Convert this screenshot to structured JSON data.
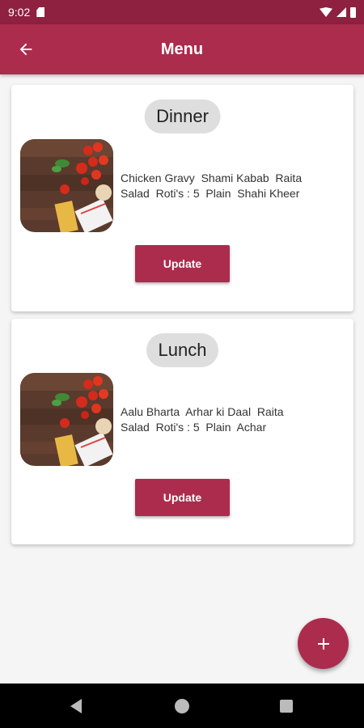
{
  "status_bar": {
    "time": "9:02"
  },
  "app_bar": {
    "title": "Menu",
    "back_icon": "arrow-back-icon"
  },
  "cards": [
    {
      "meal": "Dinner",
      "items": "Chicken Gravy  Shami Kabab  Raita\nSalad  Roti's : 5  Plain  Shahi Kheer",
      "button": "Update"
    },
    {
      "meal": "Lunch",
      "items": "Aalu Bharta  Arhar ki Daal  Raita\nSalad  Roti's : 5  Plain  Achar",
      "button": "Update"
    }
  ],
  "fab": {
    "icon": "plus-icon"
  },
  "colors": {
    "primary": "#ab2c4d",
    "status_bar": "#8e2040",
    "pill": "#dedede"
  }
}
